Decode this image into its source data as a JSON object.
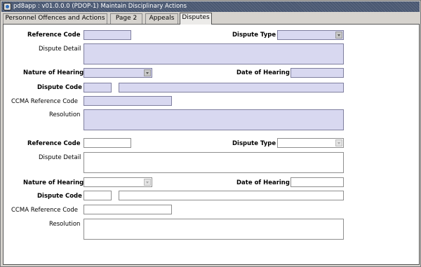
{
  "window": {
    "title": "pd8app : v01.0.0.0 (PDOP-1) Maintain Disciplinary Actions"
  },
  "tabs": [
    {
      "label": "Personnel Offences and Actions"
    },
    {
      "label": "Page 2"
    },
    {
      "label": "Appeals"
    },
    {
      "label": "Disputes",
      "active": true
    }
  ],
  "form": {
    "labels": {
      "reference_code": "Reference Code",
      "dispute_type": "Dispute Type",
      "dispute_detail": "Dispute Detail",
      "nature_of_hearing": "Nature of Hearing",
      "date_of_hearing": "Date of Hearing",
      "dispute_code": "Dispute Code",
      "ccma_reference_code": "CCMA Reference Code",
      "resolution": "Resolution"
    },
    "records": [
      {
        "reference_code": "",
        "dispute_type": "",
        "dispute_detail": "",
        "nature_of_hearing": "",
        "date_of_hearing": "",
        "dispute_code": "",
        "dispute_description": "",
        "ccma_reference_code": "",
        "resolution": ""
      },
      {
        "reference_code": "",
        "dispute_type": "",
        "dispute_detail": "",
        "nature_of_hearing": "",
        "date_of_hearing": "",
        "dispute_code": "",
        "dispute_description": "",
        "ccma_reference_code": "",
        "resolution": ""
      }
    ]
  },
  "colors": {
    "active_field": "#d8d8f0",
    "inactive_field": "#ffffff",
    "window_bg": "#d6d3ce",
    "titlebar": "#4a5872"
  }
}
